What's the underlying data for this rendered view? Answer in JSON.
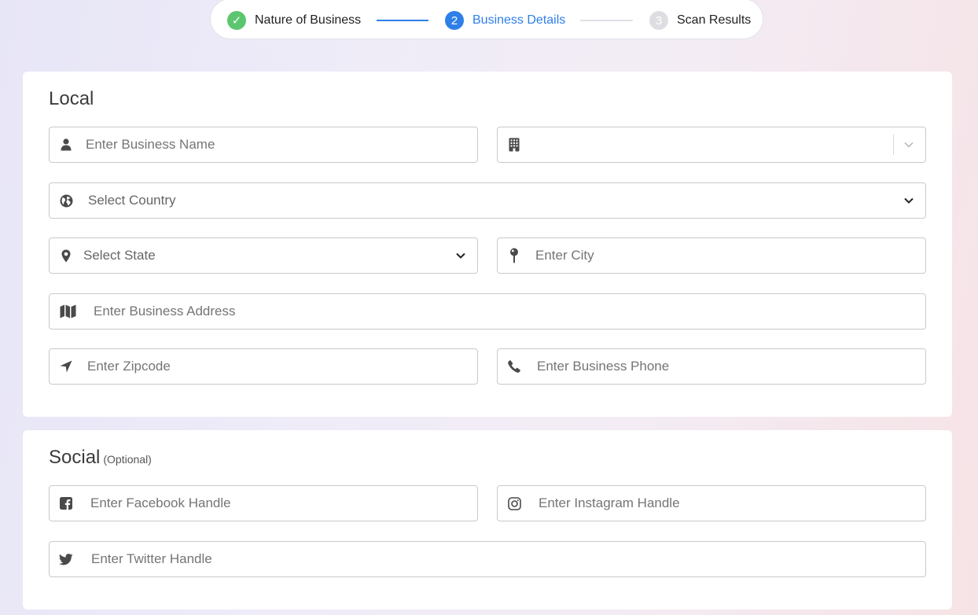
{
  "stepper": {
    "steps": [
      {
        "label": "Nature of Business",
        "marker": "✓",
        "state": "complete"
      },
      {
        "label": "Business Details",
        "marker": "2",
        "state": "active"
      },
      {
        "label": "Scan Results",
        "marker": "3",
        "state": "pending"
      }
    ]
  },
  "local": {
    "title": "Local",
    "business_name": {
      "placeholder": "Enter Business Name",
      "icon": "user-icon"
    },
    "business_type": {
      "value": "",
      "icon": "building-icon"
    },
    "country": {
      "placeholder": "Select Country",
      "icon": "globe-icon"
    },
    "state": {
      "placeholder": "Select State",
      "icon": "map-marker-icon"
    },
    "city": {
      "placeholder": "Enter City",
      "icon": "map-pin-icon"
    },
    "address": {
      "placeholder": "Enter Business Address",
      "icon": "map-icon"
    },
    "zipcode": {
      "placeholder": "Enter Zipcode",
      "icon": "location-arrow-icon"
    },
    "phone": {
      "placeholder": "Enter Business Phone",
      "icon": "phone-icon"
    }
  },
  "social": {
    "title": "Social",
    "optional_label": "(Optional)",
    "facebook": {
      "placeholder": "Enter Facebook Handle",
      "icon": "facebook-icon"
    },
    "instagram": {
      "placeholder": "Enter Instagram Handle",
      "icon": "instagram-icon"
    },
    "twitter": {
      "placeholder": "Enter Twitter Handle",
      "icon": "twitter-icon"
    }
  },
  "colors": {
    "accent": "#2f7fe8",
    "complete": "#5cc66e",
    "pending": "#dedee2"
  }
}
